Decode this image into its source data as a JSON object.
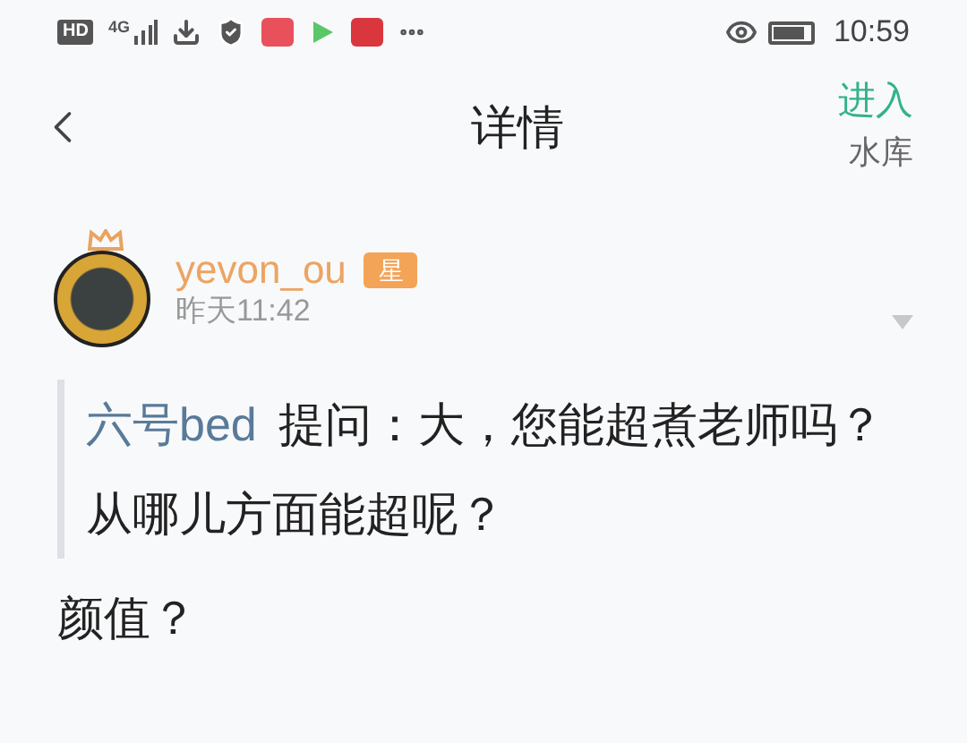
{
  "status_bar": {
    "hd": "HD",
    "network": "4G",
    "time": "10:59"
  },
  "header": {
    "title": "详情",
    "action": "进入",
    "subtitle": "水库"
  },
  "post": {
    "author": "yevon_ou",
    "badge": "星",
    "time": "昨天11:42",
    "quote": {
      "asker": "六号bed",
      "text": "提问：大，您能超煮老师吗？从哪儿方面能超呢？"
    },
    "answer": "颜值？"
  }
}
